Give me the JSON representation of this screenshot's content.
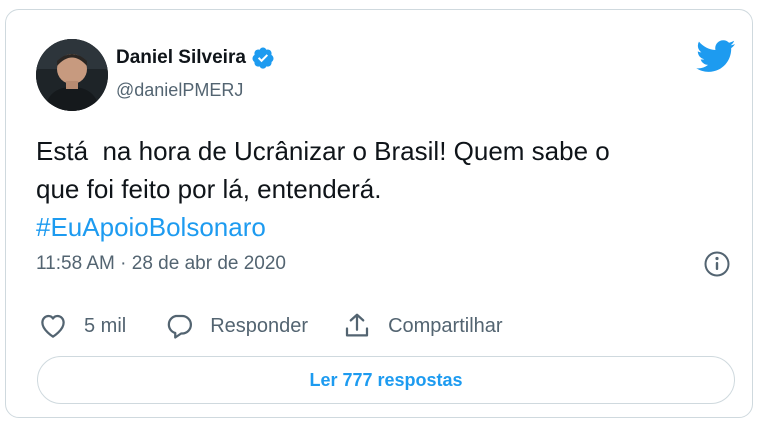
{
  "tweet": {
    "author": {
      "display_name": "Daniel Silveira",
      "handle": "@danielPMERJ",
      "verified": true
    },
    "text_line1": "Está  na hora de Ucrânizar o Brasil! Quem sabe o",
    "text_line2": "que foi feito por lá, entenderá.",
    "hashtag": "#EuApoioBolsonaro",
    "timestamp": "11:58 AM · 28 de abr de 2020"
  },
  "actions": {
    "like_count": "5 mil",
    "reply_label": "Responder",
    "share_label": "Compartilhar"
  },
  "replies_button": {
    "label": "Ler 777 respostas"
  },
  "icons": {
    "brand": "twitter-bird-icon",
    "verified": "verified-badge-icon",
    "info": "info-icon",
    "like": "heart-icon",
    "reply": "speech-bubble-icon",
    "share": "share-upload-icon"
  },
  "colors": {
    "accent": "#1d9bf0",
    "text_primary": "#0f1419",
    "text_secondary": "#536471",
    "border": "#cfd9de"
  }
}
